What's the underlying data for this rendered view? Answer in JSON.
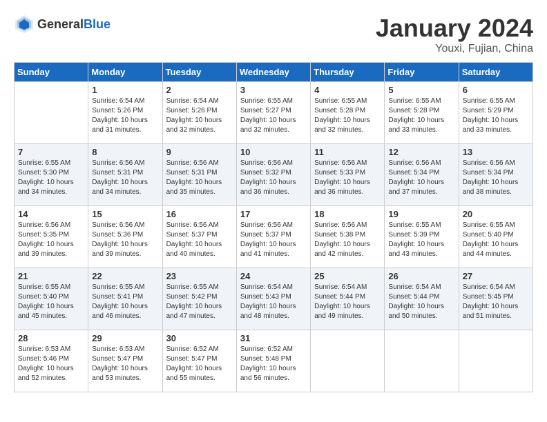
{
  "header": {
    "logo_general": "General",
    "logo_blue": "Blue",
    "title": "January 2024",
    "location": "Youxi, Fujian, China"
  },
  "weekdays": [
    "Sunday",
    "Monday",
    "Tuesday",
    "Wednesday",
    "Thursday",
    "Friday",
    "Saturday"
  ],
  "weeks": [
    [
      {
        "day": "",
        "sunrise": "",
        "sunset": "",
        "daylight": ""
      },
      {
        "day": "1",
        "sunrise": "Sunrise: 6:54 AM",
        "sunset": "Sunset: 5:26 PM",
        "daylight": "Daylight: 10 hours and 31 minutes."
      },
      {
        "day": "2",
        "sunrise": "Sunrise: 6:54 AM",
        "sunset": "Sunset: 5:26 PM",
        "daylight": "Daylight: 10 hours and 32 minutes."
      },
      {
        "day": "3",
        "sunrise": "Sunrise: 6:55 AM",
        "sunset": "Sunset: 5:27 PM",
        "daylight": "Daylight: 10 hours and 32 minutes."
      },
      {
        "day": "4",
        "sunrise": "Sunrise: 6:55 AM",
        "sunset": "Sunset: 5:28 PM",
        "daylight": "Daylight: 10 hours and 32 minutes."
      },
      {
        "day": "5",
        "sunrise": "Sunrise: 6:55 AM",
        "sunset": "Sunset: 5:28 PM",
        "daylight": "Daylight: 10 hours and 33 minutes."
      },
      {
        "day": "6",
        "sunrise": "Sunrise: 6:55 AM",
        "sunset": "Sunset: 5:29 PM",
        "daylight": "Daylight: 10 hours and 33 minutes."
      }
    ],
    [
      {
        "day": "7",
        "sunrise": "Sunrise: 6:55 AM",
        "sunset": "Sunset: 5:30 PM",
        "daylight": "Daylight: 10 hours and 34 minutes."
      },
      {
        "day": "8",
        "sunrise": "Sunrise: 6:56 AM",
        "sunset": "Sunset: 5:31 PM",
        "daylight": "Daylight: 10 hours and 34 minutes."
      },
      {
        "day": "9",
        "sunrise": "Sunrise: 6:56 AM",
        "sunset": "Sunset: 5:31 PM",
        "daylight": "Daylight: 10 hours and 35 minutes."
      },
      {
        "day": "10",
        "sunrise": "Sunrise: 6:56 AM",
        "sunset": "Sunset: 5:32 PM",
        "daylight": "Daylight: 10 hours and 36 minutes."
      },
      {
        "day": "11",
        "sunrise": "Sunrise: 6:56 AM",
        "sunset": "Sunset: 5:33 PM",
        "daylight": "Daylight: 10 hours and 36 minutes."
      },
      {
        "day": "12",
        "sunrise": "Sunrise: 6:56 AM",
        "sunset": "Sunset: 5:34 PM",
        "daylight": "Daylight: 10 hours and 37 minutes."
      },
      {
        "day": "13",
        "sunrise": "Sunrise: 6:56 AM",
        "sunset": "Sunset: 5:34 PM",
        "daylight": "Daylight: 10 hours and 38 minutes."
      }
    ],
    [
      {
        "day": "14",
        "sunrise": "Sunrise: 6:56 AM",
        "sunset": "Sunset: 5:35 PM",
        "daylight": "Daylight: 10 hours and 39 minutes."
      },
      {
        "day": "15",
        "sunrise": "Sunrise: 6:56 AM",
        "sunset": "Sunset: 5:36 PM",
        "daylight": "Daylight: 10 hours and 39 minutes."
      },
      {
        "day": "16",
        "sunrise": "Sunrise: 6:56 AM",
        "sunset": "Sunset: 5:37 PM",
        "daylight": "Daylight: 10 hours and 40 minutes."
      },
      {
        "day": "17",
        "sunrise": "Sunrise: 6:56 AM",
        "sunset": "Sunset: 5:37 PM",
        "daylight": "Daylight: 10 hours and 41 minutes."
      },
      {
        "day": "18",
        "sunrise": "Sunrise: 6:56 AM",
        "sunset": "Sunset: 5:38 PM",
        "daylight": "Daylight: 10 hours and 42 minutes."
      },
      {
        "day": "19",
        "sunrise": "Sunrise: 6:55 AM",
        "sunset": "Sunset: 5:39 PM",
        "daylight": "Daylight: 10 hours and 43 minutes."
      },
      {
        "day": "20",
        "sunrise": "Sunrise: 6:55 AM",
        "sunset": "Sunset: 5:40 PM",
        "daylight": "Daylight: 10 hours and 44 minutes."
      }
    ],
    [
      {
        "day": "21",
        "sunrise": "Sunrise: 6:55 AM",
        "sunset": "Sunset: 5:40 PM",
        "daylight": "Daylight: 10 hours and 45 minutes."
      },
      {
        "day": "22",
        "sunrise": "Sunrise: 6:55 AM",
        "sunset": "Sunset: 5:41 PM",
        "daylight": "Daylight: 10 hours and 46 minutes."
      },
      {
        "day": "23",
        "sunrise": "Sunrise: 6:55 AM",
        "sunset": "Sunset: 5:42 PM",
        "daylight": "Daylight: 10 hours and 47 minutes."
      },
      {
        "day": "24",
        "sunrise": "Sunrise: 6:54 AM",
        "sunset": "Sunset: 5:43 PM",
        "daylight": "Daylight: 10 hours and 48 minutes."
      },
      {
        "day": "25",
        "sunrise": "Sunrise: 6:54 AM",
        "sunset": "Sunset: 5:44 PM",
        "daylight": "Daylight: 10 hours and 49 minutes."
      },
      {
        "day": "26",
        "sunrise": "Sunrise: 6:54 AM",
        "sunset": "Sunset: 5:44 PM",
        "daylight": "Daylight: 10 hours and 50 minutes."
      },
      {
        "day": "27",
        "sunrise": "Sunrise: 6:54 AM",
        "sunset": "Sunset: 5:45 PM",
        "daylight": "Daylight: 10 hours and 51 minutes."
      }
    ],
    [
      {
        "day": "28",
        "sunrise": "Sunrise: 6:53 AM",
        "sunset": "Sunset: 5:46 PM",
        "daylight": "Daylight: 10 hours and 52 minutes."
      },
      {
        "day": "29",
        "sunrise": "Sunrise: 6:53 AM",
        "sunset": "Sunset: 5:47 PM",
        "daylight": "Daylight: 10 hours and 53 minutes."
      },
      {
        "day": "30",
        "sunrise": "Sunrise: 6:52 AM",
        "sunset": "Sunset: 5:47 PM",
        "daylight": "Daylight: 10 hours and 55 minutes."
      },
      {
        "day": "31",
        "sunrise": "Sunrise: 6:52 AM",
        "sunset": "Sunset: 5:48 PM",
        "daylight": "Daylight: 10 hours and 56 minutes."
      },
      {
        "day": "",
        "sunrise": "",
        "sunset": "",
        "daylight": ""
      },
      {
        "day": "",
        "sunrise": "",
        "sunset": "",
        "daylight": ""
      },
      {
        "day": "",
        "sunrise": "",
        "sunset": "",
        "daylight": ""
      }
    ]
  ]
}
